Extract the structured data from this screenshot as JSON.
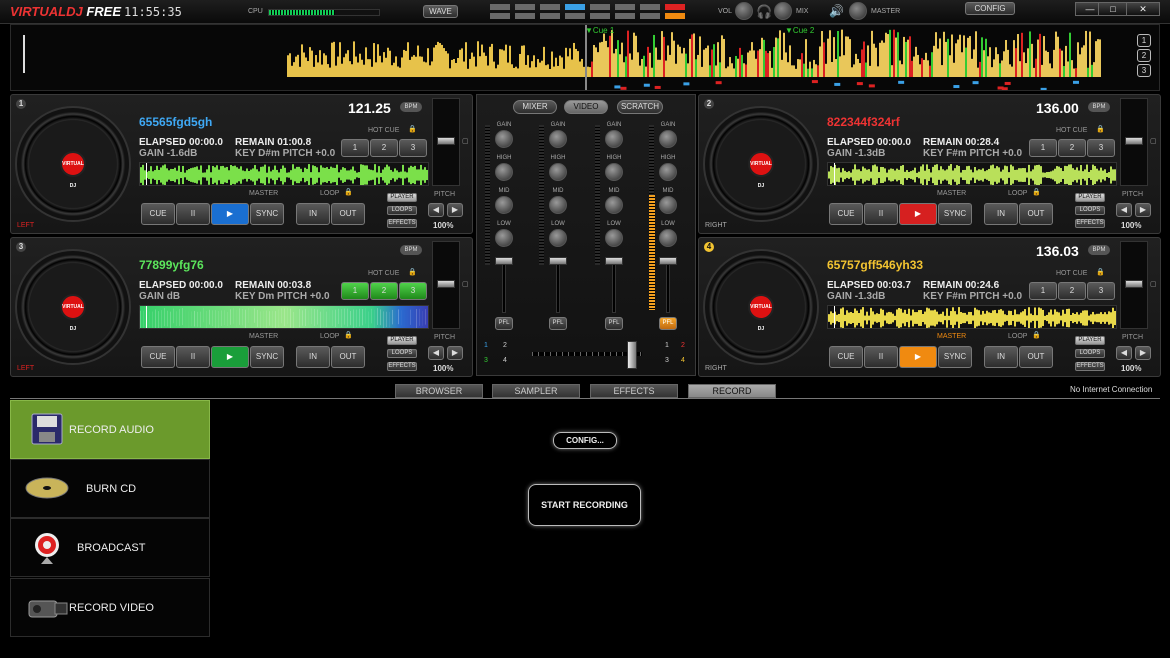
{
  "app": {
    "logo_a": "VIRTUAL",
    "logo_b": "DJ",
    "logo_c": " FREE",
    "clock": "11:55:35",
    "cpu_label": "CPU",
    "cpu_load": 0.6,
    "wave_btn": "WAVE",
    "vol_label": "VOL",
    "mix_label": "MIX",
    "master_label": "MASTER",
    "config_btn": "CONFIG",
    "win_min": "—",
    "win_max": "□",
    "win_close": "✕"
  },
  "overview": {
    "cue1": "Cue 1",
    "cue2": "Cue 2",
    "deck_buttons": [
      "1",
      "2",
      "3"
    ]
  },
  "decks": [
    {
      "num": "1",
      "title": "65565fgd5gh",
      "title_color": "#3fa9f5",
      "bpm": "121.25",
      "bpm_label": "BPM",
      "elapsed": "ELAPSED 00:00.0",
      "remain": "REMAIN 01:00.8",
      "gain": "GAIN -1.6dB",
      "key": "KEY D#m  PITCH +0.0",
      "side": "LEFT",
      "pitch": "100%",
      "play_color": "#1a6fd1",
      "wave_color": "#7be04a",
      "hot_active": false,
      "master_active": false
    },
    {
      "num": "2",
      "title": "822344f324rf",
      "title_color": "#e33",
      "bpm": "136.00",
      "bpm_label": "BPM",
      "elapsed": "ELAPSED 00:00.0",
      "remain": "REMAIN 00:28.4",
      "gain": "GAIN -1.3dB",
      "key": "KEY F#m  PITCH +0.0",
      "side": "RIGHT",
      "pitch": "100%",
      "play_color": "#d62020",
      "wave_color": "#b9e05a",
      "hot_active": false,
      "master_active": false
    },
    {
      "num": "3",
      "title": "77899yfg76",
      "title_color": "#5ce65c",
      "bpm": "",
      "bpm_label": "BPM",
      "elapsed": "ELAPSED 00:00.0",
      "remain": "REMAIN 00:03.8",
      "gain": "GAIN dB",
      "key": "KEY Dm  PITCH +0.0",
      "side": "LEFT",
      "pitch": "100%",
      "play_color": "#1a9e3a",
      "wave_color": "#35d06a",
      "hot_active": true,
      "master_active": false
    },
    {
      "num": "4",
      "title": "65757gff546yh33",
      "title_color": "#f3c431",
      "bpm": "136.03",
      "bpm_label": "BPM",
      "elapsed": "ELAPSED 00:03.7",
      "remain": "REMAIN 00:24.6",
      "gain": "GAIN -1.3dB",
      "key": "KEY F#m  PITCH +0.0",
      "side": "RIGHT",
      "pitch": "100%",
      "play_color": "#f08a10",
      "wave_color": "#e8d84a",
      "hot_active": false,
      "master_active": true
    }
  ],
  "deck_labels": {
    "hot_cue": "HOT CUE",
    "loop": "LOOP",
    "master": "MASTER",
    "pitch": "PITCH",
    "cue": "CUE",
    "pause": "II",
    "play": "▶",
    "sync": "SYNC",
    "in": "IN",
    "out": "OUT",
    "player": "PLAYER",
    "loops": "LOOPS",
    "effects": "EFFECTS",
    "hot": [
      "1",
      "2",
      "3"
    ]
  },
  "mixer": {
    "tabs": [
      "MIXER",
      "VIDEO",
      "SCRATCH"
    ],
    "active_tab": "VIDEO",
    "knobs": [
      "GAIN",
      "HIGH",
      "MID",
      "LOW"
    ],
    "pfl": "PFL",
    "cross_left": [
      "1",
      "2",
      "3",
      "4"
    ],
    "cross_right": [
      "1",
      "2",
      "3",
      "4"
    ]
  },
  "browser_tabs": [
    "BROWSER",
    "SAMPLER",
    "EFFECTS",
    "RECORD"
  ],
  "active_browser_tab": "RECORD",
  "status": "No Internet Connection",
  "record_menu": [
    {
      "label": "RECORD AUDIO",
      "icon": "floppy-disk-icon",
      "active": true
    },
    {
      "label": "BURN CD",
      "icon": "cd-disc-icon",
      "active": false
    },
    {
      "label": "BROADCAST",
      "icon": "broadcast-icon",
      "active": false
    },
    {
      "label": "RECORD VIDEO",
      "icon": "video-camera-icon",
      "active": false
    }
  ],
  "record_panel": {
    "config_btn": "CONFIG...",
    "start_btn": "START RECORDING"
  },
  "colors": {
    "accent_green": "#6b9a2c",
    "deck_blue": "#1a6fd1"
  }
}
